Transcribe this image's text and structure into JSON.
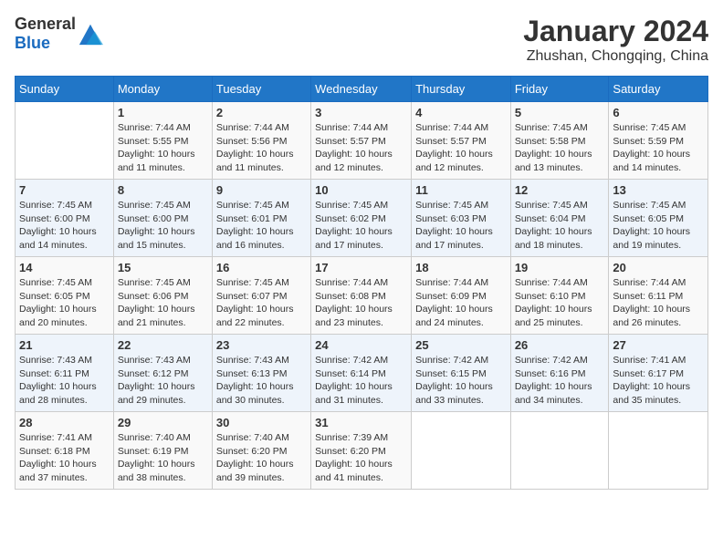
{
  "header": {
    "logo_general": "General",
    "logo_blue": "Blue",
    "month_year": "January 2024",
    "location": "Zhushan, Chongqing, China"
  },
  "weekdays": [
    "Sunday",
    "Monday",
    "Tuesday",
    "Wednesday",
    "Thursday",
    "Friday",
    "Saturday"
  ],
  "weeks": [
    [
      {
        "day": "",
        "info": ""
      },
      {
        "day": "1",
        "info": "Sunrise: 7:44 AM\nSunset: 5:55 PM\nDaylight: 10 hours\nand 11 minutes."
      },
      {
        "day": "2",
        "info": "Sunrise: 7:44 AM\nSunset: 5:56 PM\nDaylight: 10 hours\nand 11 minutes."
      },
      {
        "day": "3",
        "info": "Sunrise: 7:44 AM\nSunset: 5:57 PM\nDaylight: 10 hours\nand 12 minutes."
      },
      {
        "day": "4",
        "info": "Sunrise: 7:44 AM\nSunset: 5:57 PM\nDaylight: 10 hours\nand 12 minutes."
      },
      {
        "day": "5",
        "info": "Sunrise: 7:45 AM\nSunset: 5:58 PM\nDaylight: 10 hours\nand 13 minutes."
      },
      {
        "day": "6",
        "info": "Sunrise: 7:45 AM\nSunset: 5:59 PM\nDaylight: 10 hours\nand 14 minutes."
      }
    ],
    [
      {
        "day": "7",
        "info": "Sunrise: 7:45 AM\nSunset: 6:00 PM\nDaylight: 10 hours\nand 14 minutes."
      },
      {
        "day": "8",
        "info": "Sunrise: 7:45 AM\nSunset: 6:00 PM\nDaylight: 10 hours\nand 15 minutes."
      },
      {
        "day": "9",
        "info": "Sunrise: 7:45 AM\nSunset: 6:01 PM\nDaylight: 10 hours\nand 16 minutes."
      },
      {
        "day": "10",
        "info": "Sunrise: 7:45 AM\nSunset: 6:02 PM\nDaylight: 10 hours\nand 17 minutes."
      },
      {
        "day": "11",
        "info": "Sunrise: 7:45 AM\nSunset: 6:03 PM\nDaylight: 10 hours\nand 17 minutes."
      },
      {
        "day": "12",
        "info": "Sunrise: 7:45 AM\nSunset: 6:04 PM\nDaylight: 10 hours\nand 18 minutes."
      },
      {
        "day": "13",
        "info": "Sunrise: 7:45 AM\nSunset: 6:05 PM\nDaylight: 10 hours\nand 19 minutes."
      }
    ],
    [
      {
        "day": "14",
        "info": "Sunrise: 7:45 AM\nSunset: 6:05 PM\nDaylight: 10 hours\nand 20 minutes."
      },
      {
        "day": "15",
        "info": "Sunrise: 7:45 AM\nSunset: 6:06 PM\nDaylight: 10 hours\nand 21 minutes."
      },
      {
        "day": "16",
        "info": "Sunrise: 7:45 AM\nSunset: 6:07 PM\nDaylight: 10 hours\nand 22 minutes."
      },
      {
        "day": "17",
        "info": "Sunrise: 7:44 AM\nSunset: 6:08 PM\nDaylight: 10 hours\nand 23 minutes."
      },
      {
        "day": "18",
        "info": "Sunrise: 7:44 AM\nSunset: 6:09 PM\nDaylight: 10 hours\nand 24 minutes."
      },
      {
        "day": "19",
        "info": "Sunrise: 7:44 AM\nSunset: 6:10 PM\nDaylight: 10 hours\nand 25 minutes."
      },
      {
        "day": "20",
        "info": "Sunrise: 7:44 AM\nSunset: 6:11 PM\nDaylight: 10 hours\nand 26 minutes."
      }
    ],
    [
      {
        "day": "21",
        "info": "Sunrise: 7:43 AM\nSunset: 6:11 PM\nDaylight: 10 hours\nand 28 minutes."
      },
      {
        "day": "22",
        "info": "Sunrise: 7:43 AM\nSunset: 6:12 PM\nDaylight: 10 hours\nand 29 minutes."
      },
      {
        "day": "23",
        "info": "Sunrise: 7:43 AM\nSunset: 6:13 PM\nDaylight: 10 hours\nand 30 minutes."
      },
      {
        "day": "24",
        "info": "Sunrise: 7:42 AM\nSunset: 6:14 PM\nDaylight: 10 hours\nand 31 minutes."
      },
      {
        "day": "25",
        "info": "Sunrise: 7:42 AM\nSunset: 6:15 PM\nDaylight: 10 hours\nand 33 minutes."
      },
      {
        "day": "26",
        "info": "Sunrise: 7:42 AM\nSunset: 6:16 PM\nDaylight: 10 hours\nand 34 minutes."
      },
      {
        "day": "27",
        "info": "Sunrise: 7:41 AM\nSunset: 6:17 PM\nDaylight: 10 hours\nand 35 minutes."
      }
    ],
    [
      {
        "day": "28",
        "info": "Sunrise: 7:41 AM\nSunset: 6:18 PM\nDaylight: 10 hours\nand 37 minutes."
      },
      {
        "day": "29",
        "info": "Sunrise: 7:40 AM\nSunset: 6:19 PM\nDaylight: 10 hours\nand 38 minutes."
      },
      {
        "day": "30",
        "info": "Sunrise: 7:40 AM\nSunset: 6:20 PM\nDaylight: 10 hours\nand 39 minutes."
      },
      {
        "day": "31",
        "info": "Sunrise: 7:39 AM\nSunset: 6:20 PM\nDaylight: 10 hours\nand 41 minutes."
      },
      {
        "day": "",
        "info": ""
      },
      {
        "day": "",
        "info": ""
      },
      {
        "day": "",
        "info": ""
      }
    ]
  ]
}
